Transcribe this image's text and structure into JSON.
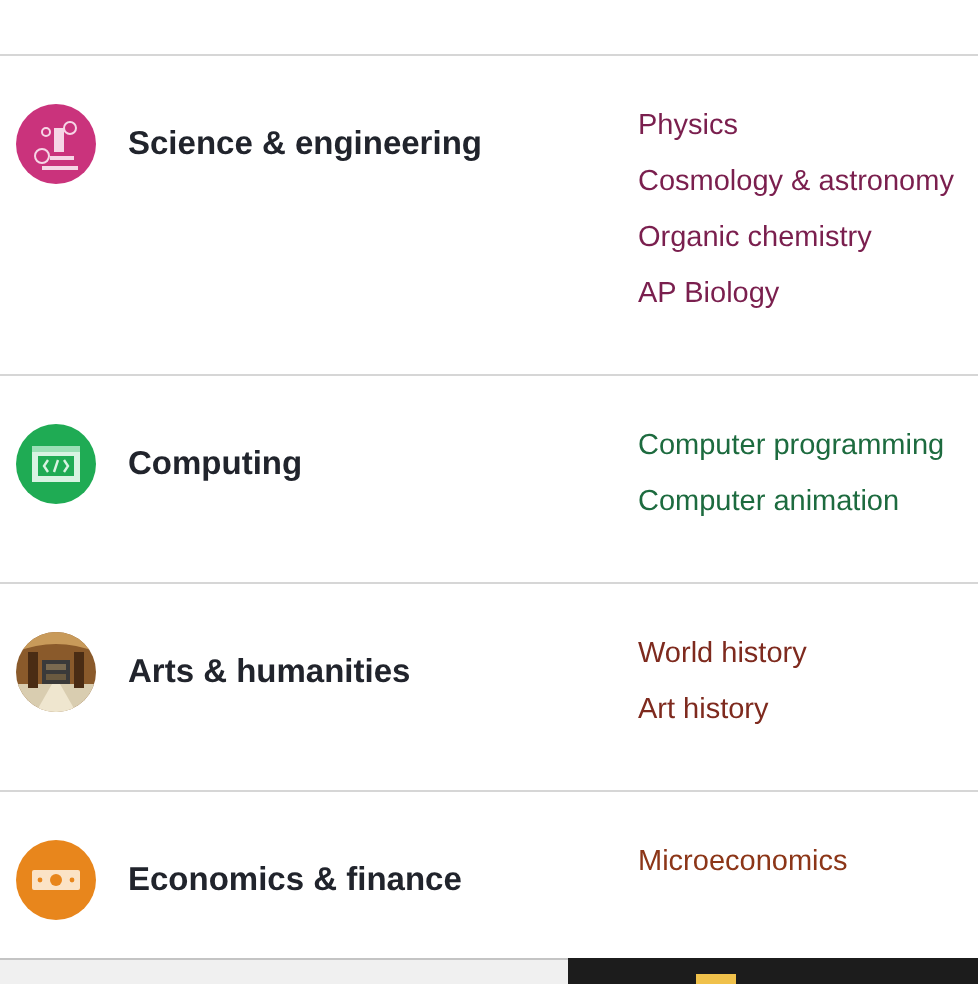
{
  "sections": [
    {
      "title": "Science & engineering",
      "kind": "science",
      "color": "#7a1f4e",
      "links": [
        "Physics",
        "Cosmology & astronomy",
        "Organic chemistry",
        "AP Biology"
      ]
    },
    {
      "title": "Computing",
      "kind": "computing",
      "color": "#1d6b3f",
      "links": [
        "Computer programming",
        "Computer animation"
      ]
    },
    {
      "title": "Arts & humanities",
      "kind": "picture",
      "color": "#7e2a1e",
      "links": [
        "World history",
        "Art history"
      ]
    },
    {
      "title": "Economics & finance",
      "kind": "economics",
      "color": "#8c3618",
      "links": [
        "Microeconomics"
      ]
    }
  ]
}
